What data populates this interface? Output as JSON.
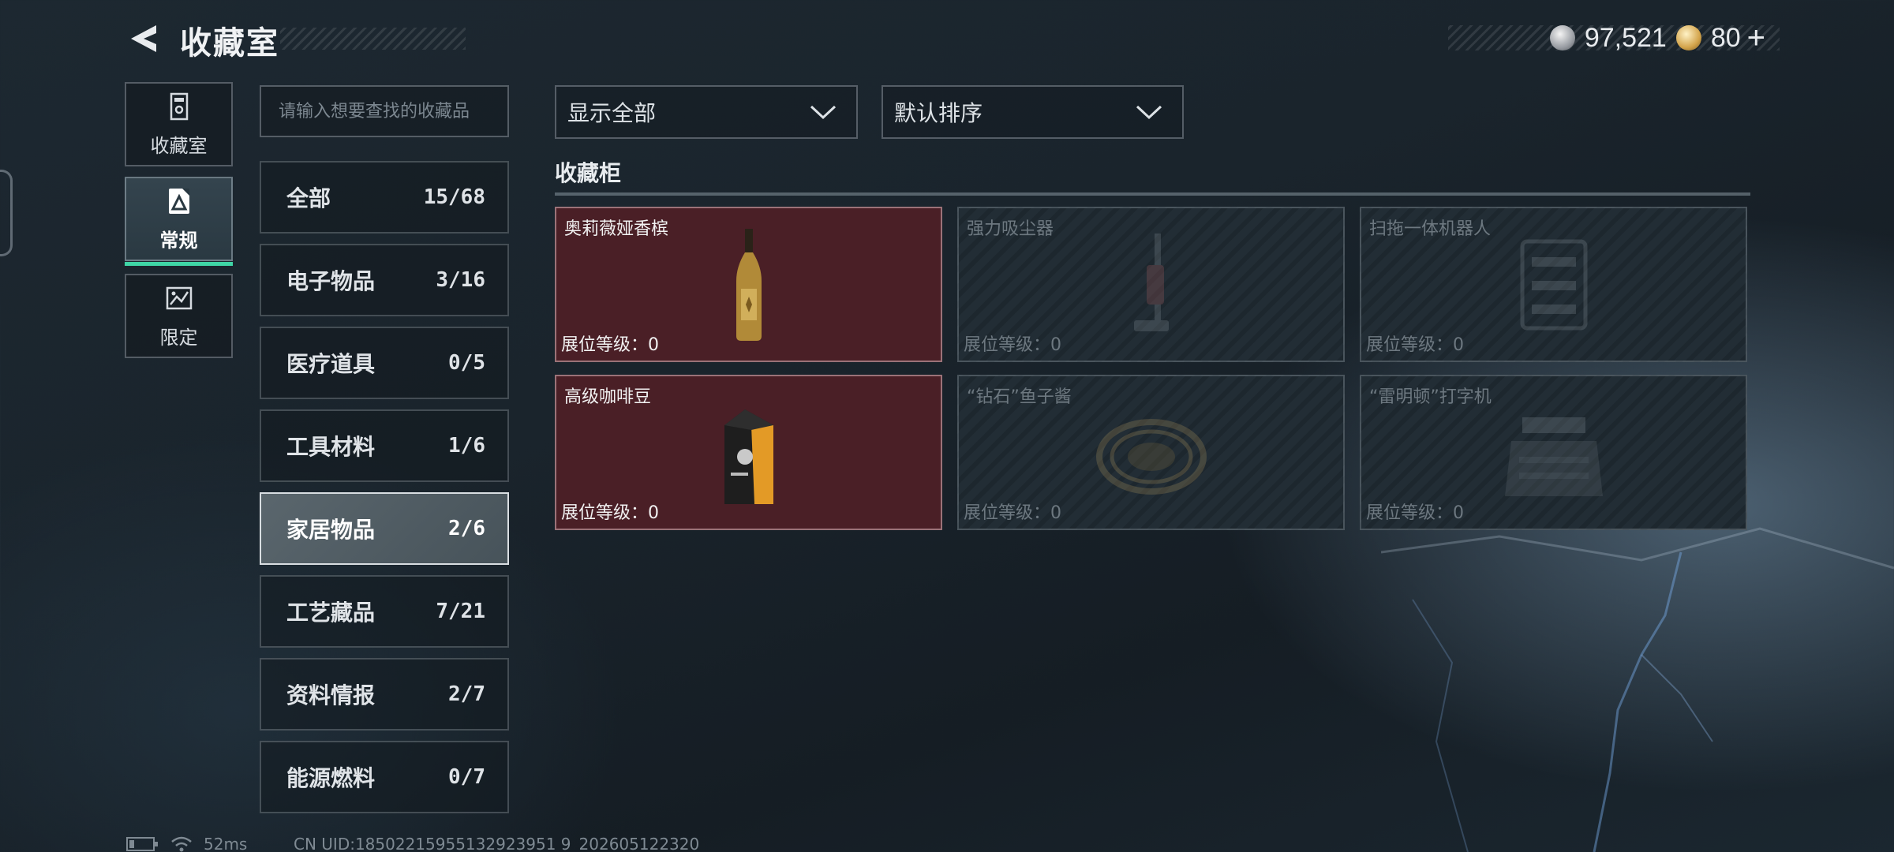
{
  "header": {
    "title": "收藏室",
    "currency": [
      {
        "icon": "silver-coin-icon",
        "value": "97,521"
      },
      {
        "icon": "gold-coin-icon",
        "value": "80"
      }
    ],
    "add_label": "+"
  },
  "side_tabs": [
    {
      "label": "收藏室",
      "icon": "trophy-cabinet-icon",
      "active": false
    },
    {
      "label": "常规",
      "icon": "regular-collection-icon",
      "active": true
    },
    {
      "label": "限定",
      "icon": "limited-collection-icon",
      "active": false
    }
  ],
  "search": {
    "placeholder": "请输入想要查找的收藏品"
  },
  "categories": [
    {
      "name": "全部",
      "count": "15/68"
    },
    {
      "name": "电子物品",
      "count": "3/16"
    },
    {
      "name": "医疗道具",
      "count": "0/5"
    },
    {
      "name": "工具材料",
      "count": "1/6"
    },
    {
      "name": "家居物品",
      "count": "2/6",
      "active": true
    },
    {
      "name": "工艺藏品",
      "count": "7/21"
    },
    {
      "name": "资料情报",
      "count": "2/7"
    },
    {
      "name": "能源燃料",
      "count": "0/7"
    }
  ],
  "filters": {
    "display": "显示全部",
    "sort": "默认排序"
  },
  "section": {
    "title": "收藏柜"
  },
  "items": [
    {
      "name": "奥莉薇娅香槟",
      "level": "展位等级：0",
      "owned": true,
      "art": "champagne-bottle"
    },
    {
      "name": "强力吸尘器",
      "level": "展位等级：0",
      "owned": false,
      "art": "vacuum-cleaner"
    },
    {
      "name": "扫拖一体机器人",
      "level": "展位等级：0",
      "owned": false,
      "art": "robot-mop"
    },
    {
      "name": "高级咖啡豆",
      "level": "展位等级：0",
      "owned": true,
      "art": "coffee-bag"
    },
    {
      "name": "“钻石”鱼子酱",
      "level": "展位等级：0",
      "owned": false,
      "art": "caviar-tin"
    },
    {
      "name": "“雷明顿”打字机",
      "level": "展位等级：0",
      "owned": false,
      "art": "typewriter"
    }
  ],
  "status_bar": {
    "ping": "52ms",
    "uid": "CN UID:18502215955132923951 9_202605122320"
  }
}
